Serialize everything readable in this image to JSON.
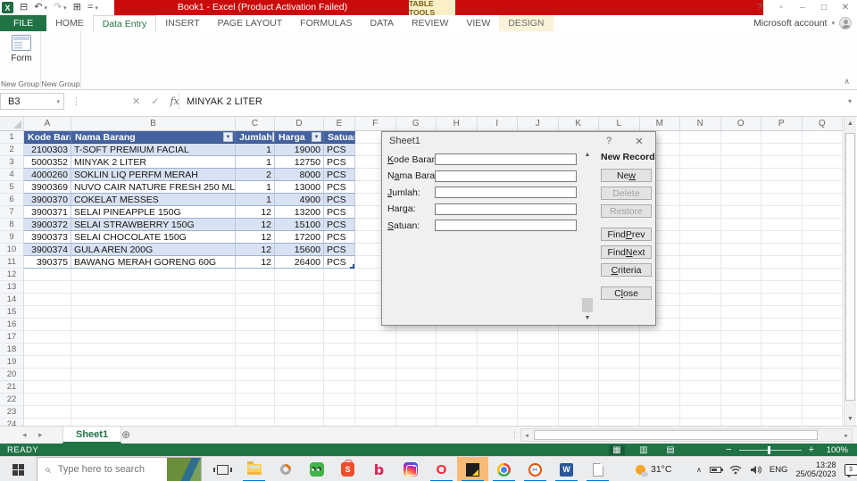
{
  "titlebar": {
    "title": "Book1 -  Excel (Product Activation Failed)",
    "context_header": "TABLE TOOLS"
  },
  "account": {
    "label": "Microsoft account"
  },
  "ribbon": {
    "tabs": [
      {
        "label": "FILE",
        "type": "file"
      },
      {
        "label": "HOME"
      },
      {
        "label": "Data Entry",
        "active": true
      },
      {
        "label": "INSERT"
      },
      {
        "label": "PAGE LAYOUT"
      },
      {
        "label": "FORMULAS"
      },
      {
        "label": "DATA"
      },
      {
        "label": "REVIEW"
      },
      {
        "label": "VIEW"
      },
      {
        "label": "DESIGN",
        "contextual": true
      }
    ],
    "form_button": "Form",
    "group_labels": [
      "New Group",
      "New Group"
    ]
  },
  "formula_bar": {
    "name_box": "B3",
    "formula": "MINYAK 2 LITER"
  },
  "sheet": {
    "columns": [
      "A",
      "B",
      "C",
      "D",
      "E",
      "F",
      "G",
      "H",
      "I",
      "J",
      "K",
      "L",
      "M",
      "N",
      "O",
      "P",
      "Q"
    ],
    "visible_rows": 24,
    "table": {
      "headers": [
        "Kode Barang",
        "Nama Barang",
        "Jumlah",
        "Harga",
        "Satuan"
      ],
      "rows": [
        [
          "2100303",
          "T-SOFT PREMIUM FACIAL",
          "1",
          "19000",
          "PCS"
        ],
        [
          "5000352",
          "MINYAK 2 LITER",
          "1",
          "12750",
          "PCS"
        ],
        [
          "4000260",
          "SOKLIN LIQ PERFM MERAH",
          "2",
          "8000",
          "PCS"
        ],
        [
          "3900369",
          "NUVO CAIR NATURE FRESH 250 ML",
          "1",
          "13000",
          "PCS"
        ],
        [
          "3900370",
          "COKELAT MESSES",
          "1",
          "4900",
          "PCS"
        ],
        [
          "3900371",
          "SELAI PINEAPPLE 150G",
          "12",
          "13200",
          "PCS"
        ],
        [
          "3900372",
          "SELAI STRAWBERRY 150G",
          "12",
          "15100",
          "PCS"
        ],
        [
          "3900373",
          "SELAI CHOCOLATE 150G",
          "12",
          "17200",
          "PCS"
        ],
        [
          "3900374",
          "GULA AREN 200G",
          "12",
          "15600",
          "PCS"
        ],
        [
          "390375",
          "BAWANG MERAH GORENG 60G",
          "12",
          "26400",
          "PCS"
        ]
      ]
    }
  },
  "form_dialog": {
    "title": "Sheet1",
    "record_indicator": "New Record",
    "fields": [
      {
        "name": "kode-barang",
        "label": "&Kode Barang:",
        "value": ""
      },
      {
        "name": "nama-barang",
        "label": "N&ama Barang:",
        "value": ""
      },
      {
        "name": "jumlah",
        "label": "&Jumlah:",
        "value": ""
      },
      {
        "name": "harga",
        "label": "Har&ga:",
        "value": ""
      },
      {
        "name": "satuan",
        "label": "&Satuan:",
        "value": ""
      }
    ],
    "buttons": [
      {
        "name": "new",
        "label": "Ne&w",
        "enabled": true
      },
      {
        "name": "delete",
        "label": "Delete",
        "enabled": false
      },
      {
        "name": "restore",
        "label": "Restore",
        "enabled": false
      },
      {
        "name": "find-prev",
        "label": "Find &Prev",
        "enabled": true,
        "gap": true
      },
      {
        "name": "find-next",
        "label": "Find &Next",
        "enabled": true
      },
      {
        "name": "criteria",
        "label": "&Criteria",
        "enabled": true
      },
      {
        "name": "close",
        "label": "C&lose",
        "enabled": true,
        "gap": true
      }
    ]
  },
  "tabbar": {
    "sheets": [
      {
        "name": "Sheet1",
        "active": true
      }
    ]
  },
  "statusbar": {
    "mode": "READY",
    "zoom_level": "100%"
  },
  "taskbar": {
    "search_placeholder": "Type here to search",
    "weather_temp": "31°C",
    "language": "ENG",
    "time": "13:28",
    "date": "25/05/2023",
    "notification_count": "3"
  }
}
